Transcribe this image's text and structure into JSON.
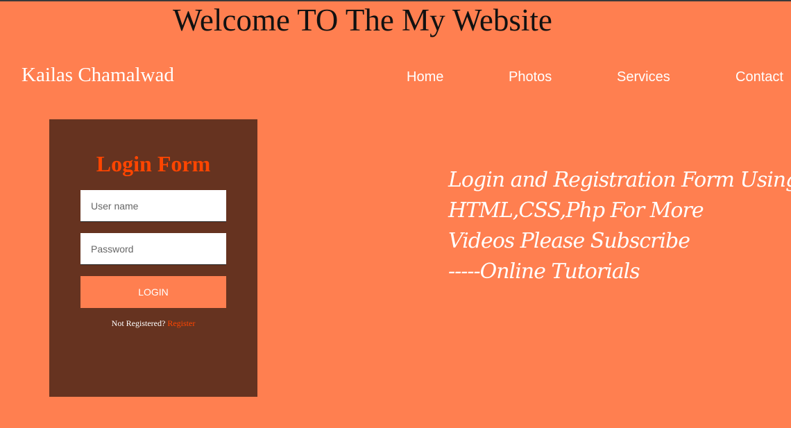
{
  "header": {
    "welcome": "Welcome TO The My Website",
    "brand": "Kailas Chamalwad"
  },
  "nav": {
    "home": "Home",
    "photos": "Photos",
    "services": "Services",
    "contact": "Contact"
  },
  "login": {
    "title": "Login Form",
    "username_placeholder": "User name",
    "password_placeholder": "Password",
    "button": "LOGIN",
    "not_registered": "Not Registered?",
    "register_link": "Register"
  },
  "promo": {
    "lines": [
      "Login and Registration Form Using",
      "HTML,CSS,Php For More",
      "Videos Please Subscribe",
      "-----Online Tutorials"
    ]
  },
  "colors": {
    "background": "#ff7f50",
    "panel": "#663320",
    "accent": "#ff4500"
  }
}
